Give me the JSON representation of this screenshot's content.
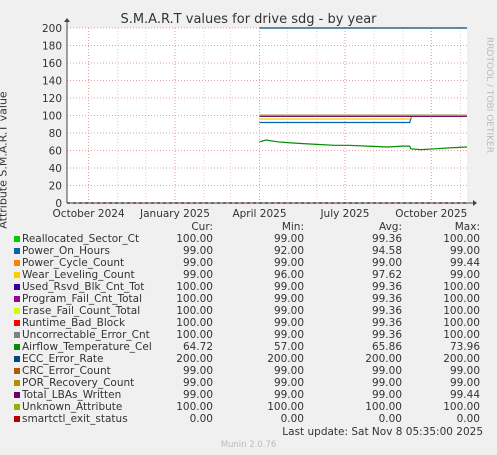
{
  "rrd_label": "RRDTOOL / TOBI OETIKER",
  "munin_version": "Munin 2.0.76",
  "last_update": "Last update: Sat Nov  8 05:35:00 2025",
  "legend_header": {
    "cur": "Cur:",
    "min": "Min:",
    "avg": "Avg:",
    "max": "Max:"
  },
  "chart_data": {
    "type": "line",
    "title": "S.M.A.R.T values for drive sdg - by year",
    "ylabel": "Attribute S.M.A.R.T value",
    "ylim": [
      0,
      200
    ],
    "yticks": [
      0,
      20,
      40,
      60,
      80,
      100,
      120,
      140,
      160,
      180,
      200
    ],
    "xlim": [
      "2024-09-08",
      "2025-11-08"
    ],
    "xticks": [
      {
        "date": "2024-10-01",
        "label": "October 2024"
      },
      {
        "date": "2025-01-01",
        "label": "January 2025"
      },
      {
        "date": "2025-04-01",
        "label": "April 2025"
      },
      {
        "date": "2025-07-01",
        "label": "July 2025"
      },
      {
        "date": "2025-10-01",
        "label": "October 2025"
      }
    ],
    "grid": true,
    "series": [
      {
        "name": "Reallocated_Sector_Ct",
        "color": "#00cc00",
        "cur": "100.00",
        "min": "99.00",
        "avg": "99.36",
        "max": "100.00",
        "points": [
          [
            "2025-04-01",
            100
          ],
          [
            "2025-11-08",
            100
          ]
        ]
      },
      {
        "name": "Power_On_Hours",
        "color": "#0066b3",
        "cur": "99.00",
        "min": "92.00",
        "avg": "94.58",
        "max": "99.00",
        "points": [
          [
            "2025-04-01",
            92
          ],
          [
            "2025-09-08",
            92
          ],
          [
            "2025-09-10",
            99
          ],
          [
            "2025-11-08",
            99
          ]
        ]
      },
      {
        "name": "Power_Cycle_Count",
        "color": "#ff8000",
        "cur": "99.00",
        "min": "99.00",
        "avg": "99.00",
        "max": "99.44",
        "points": [
          [
            "2025-04-01",
            99
          ],
          [
            "2025-11-08",
            99
          ]
        ]
      },
      {
        "name": "Wear_Leveling_Count",
        "color": "#ffcc00",
        "cur": "99.00",
        "min": "96.00",
        "avg": "97.62",
        "max": "99.00",
        "points": [
          [
            "2025-04-01",
            96
          ],
          [
            "2025-09-08",
            96
          ],
          [
            "2025-09-10",
            99
          ],
          [
            "2025-11-08",
            99
          ]
        ]
      },
      {
        "name": "Used_Rsvd_Blk_Cnt_Tot",
        "color": "#330099",
        "cur": "100.00",
        "min": "99.00",
        "avg": "99.36",
        "max": "100.00",
        "points": [
          [
            "2025-04-01",
            100
          ],
          [
            "2025-11-08",
            100
          ]
        ]
      },
      {
        "name": "Program_Fail_Cnt_Total",
        "color": "#990099",
        "cur": "100.00",
        "min": "99.00",
        "avg": "99.36",
        "max": "100.00",
        "points": [
          [
            "2025-04-01",
            100
          ],
          [
            "2025-11-08",
            100
          ]
        ]
      },
      {
        "name": "Erase_Fail_Count_Total",
        "color": "#ccff00",
        "cur": "100.00",
        "min": "99.00",
        "avg": "99.36",
        "max": "100.00",
        "points": [
          [
            "2025-04-01",
            100
          ],
          [
            "2025-11-08",
            100
          ]
        ]
      },
      {
        "name": "Runtime_Bad_Block",
        "color": "#ff0000",
        "cur": "100.00",
        "min": "99.00",
        "avg": "99.36",
        "max": "100.00",
        "points": [
          [
            "2025-04-01",
            100
          ],
          [
            "2025-11-08",
            100
          ]
        ]
      },
      {
        "name": "Uncorrectable_Error_Cnt",
        "color": "#808080",
        "cur": "100.00",
        "min": "99.00",
        "avg": "99.36",
        "max": "100.00",
        "points": [
          [
            "2025-04-01",
            100
          ],
          [
            "2025-11-08",
            100
          ]
        ]
      },
      {
        "name": "Airflow_Temperature_Cel",
        "color": "#008f00",
        "cur": "64.72",
        "min": "57.00",
        "avg": "65.86",
        "max": "73.96",
        "points": [
          [
            "2025-04-01",
            70
          ],
          [
            "2025-04-08",
            72
          ],
          [
            "2025-04-20",
            70
          ],
          [
            "2025-05-01",
            69
          ],
          [
            "2025-05-15",
            68
          ],
          [
            "2025-06-01",
            67
          ],
          [
            "2025-06-20",
            66
          ],
          [
            "2025-07-05",
            66
          ],
          [
            "2025-07-25",
            65
          ],
          [
            "2025-08-15",
            64
          ],
          [
            "2025-09-01",
            65
          ],
          [
            "2025-09-08",
            65
          ],
          [
            "2025-09-09",
            62
          ],
          [
            "2025-09-20",
            61
          ],
          [
            "2025-10-05",
            62
          ],
          [
            "2025-10-20",
            63
          ],
          [
            "2025-11-08",
            64
          ]
        ]
      },
      {
        "name": "ECC_Error_Rate",
        "color": "#00487d",
        "cur": "200.00",
        "min": "200.00",
        "avg": "200.00",
        "max": "200.00",
        "points": [
          [
            "2025-04-01",
            200
          ],
          [
            "2025-11-08",
            200
          ]
        ]
      },
      {
        "name": "CRC_Error_Count",
        "color": "#b35a00",
        "cur": "99.00",
        "min": "99.00",
        "avg": "99.00",
        "max": "99.00",
        "points": [
          [
            "2025-04-01",
            99
          ],
          [
            "2025-11-08",
            99
          ]
        ]
      },
      {
        "name": "POR_Recovery_Count",
        "color": "#b38f00",
        "cur": "99.00",
        "min": "99.00",
        "avg": "99.00",
        "max": "99.00",
        "points": [
          [
            "2025-04-01",
            99
          ],
          [
            "2025-11-08",
            99
          ]
        ]
      },
      {
        "name": "Total_LBAs_Written",
        "color": "#6b006b",
        "cur": "99.00",
        "min": "99.00",
        "avg": "99.00",
        "max": "99.44",
        "points": [
          [
            "2025-04-01",
            99
          ],
          [
            "2025-11-08",
            99
          ]
        ]
      },
      {
        "name": "Unknown_Attribute",
        "color": "#8fb300",
        "cur": "100.00",
        "min": "100.00",
        "avg": "100.00",
        "max": "100.00",
        "points": [
          [
            "2025-04-01",
            100
          ],
          [
            "2025-11-08",
            100
          ]
        ]
      },
      {
        "name": "smartctl_exit_status",
        "color": "#b30000",
        "cur": "0.00",
        "min": "0.00",
        "avg": "0.00",
        "max": "0.00",
        "points": [
          [
            "2024-09-08",
            0
          ],
          [
            "2025-11-08",
            0
          ]
        ]
      }
    ]
  }
}
